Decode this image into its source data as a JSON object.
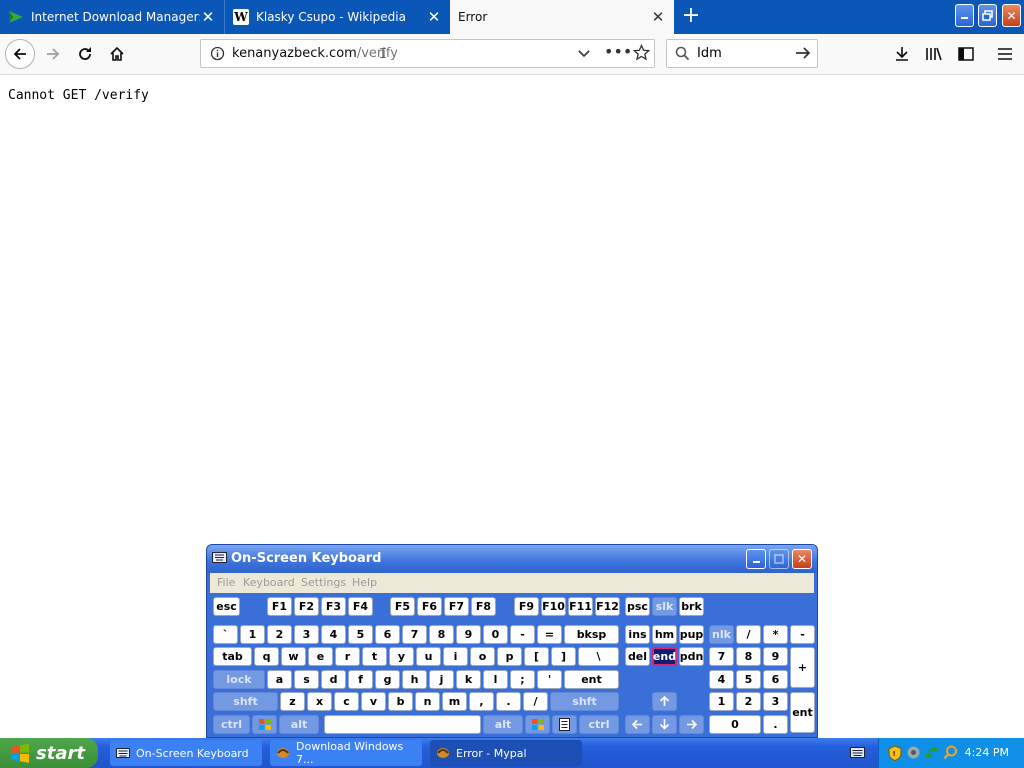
{
  "browser": {
    "tabs": [
      {
        "title": "Internet Download Manager: The",
        "icon": "idm-icon",
        "active": false
      },
      {
        "title": "Klasky Csupo - Wikipedia",
        "icon": "wikipedia-icon",
        "active": false
      },
      {
        "title": "Error",
        "icon": "",
        "active": true
      }
    ],
    "url_host": "kenanyazbeck.com",
    "url_path": "/verify",
    "search_value": "Idm"
  },
  "page": {
    "message": "Cannot GET /verify"
  },
  "osk": {
    "title": "On-Screen Keyboard",
    "menu": [
      "File",
      "Keyboard",
      "Settings",
      "Help"
    ],
    "keys": {
      "esc": "esc",
      "f1": "F1",
      "f2": "F2",
      "f3": "F3",
      "f4": "F4",
      "f5": "F5",
      "f6": "F6",
      "f7": "F7",
      "f8": "F8",
      "f9": "F9",
      "f10": "F10",
      "f11": "F11",
      "f12": "F12",
      "psc": "psc",
      "slk": "slk",
      "brk": "brk",
      "grave": "`",
      "k1": "1",
      "k2": "2",
      "k3": "3",
      "k4": "4",
      "k5": "5",
      "k6": "6",
      "k7": "7",
      "k8": "8",
      "k9": "9",
      "k0": "0",
      "minus": "-",
      "equals": "=",
      "bksp": "bksp",
      "ins": "ins",
      "hm": "hm",
      "pup": "pup",
      "nlk": "nlk",
      "slash": "/",
      "star": "*",
      "nminus": "-",
      "tab": "tab",
      "q": "q",
      "w": "w",
      "e": "e",
      "r": "r",
      "t": "t",
      "y": "y",
      "u": "u",
      "i": "i",
      "o": "o",
      "p": "p",
      "lbr": "[",
      "rbr": "]",
      "bslash": "\\",
      "del": "del",
      "end": "end",
      "pdn": "pdn",
      "n7": "7",
      "n8": "8",
      "n9": "9",
      "plus": "+",
      "lock": "lock",
      "a": "a",
      "s": "s",
      "d": "d",
      "f": "f",
      "g": "g",
      "h": "h",
      "j": "j",
      "k": "k",
      "l": "l",
      "semi": ";",
      "quote": "'",
      "ent": "ent",
      "n4": "4",
      "n5": "5",
      "n6": "6",
      "lshft": "shft",
      "z": "z",
      "x": "x",
      "c": "c",
      "v": "v",
      "b": "b",
      "n": "n",
      "m": "m",
      "comma": ",",
      "period": ".",
      "fslash": "/",
      "rshft": "shft",
      "n1": "1",
      "n2": "2",
      "n3": "3",
      "nent": "ent",
      "lctrl": "ctrl",
      "lalt": "alt",
      "ralt": "alt",
      "rctrl": "ctrl",
      "n0": "0",
      "ndot": "."
    }
  },
  "taskbar": {
    "start_label": "start",
    "items": [
      {
        "label": "On-Screen Keyboard",
        "icon": "keyboard-icon",
        "active": false
      },
      {
        "label": "Download Windows 7...",
        "icon": "mypal-icon",
        "active": false
      },
      {
        "label": "Error - Mypal",
        "icon": "mypal-icon",
        "active": true
      }
    ],
    "clock": "4:24 PM"
  }
}
